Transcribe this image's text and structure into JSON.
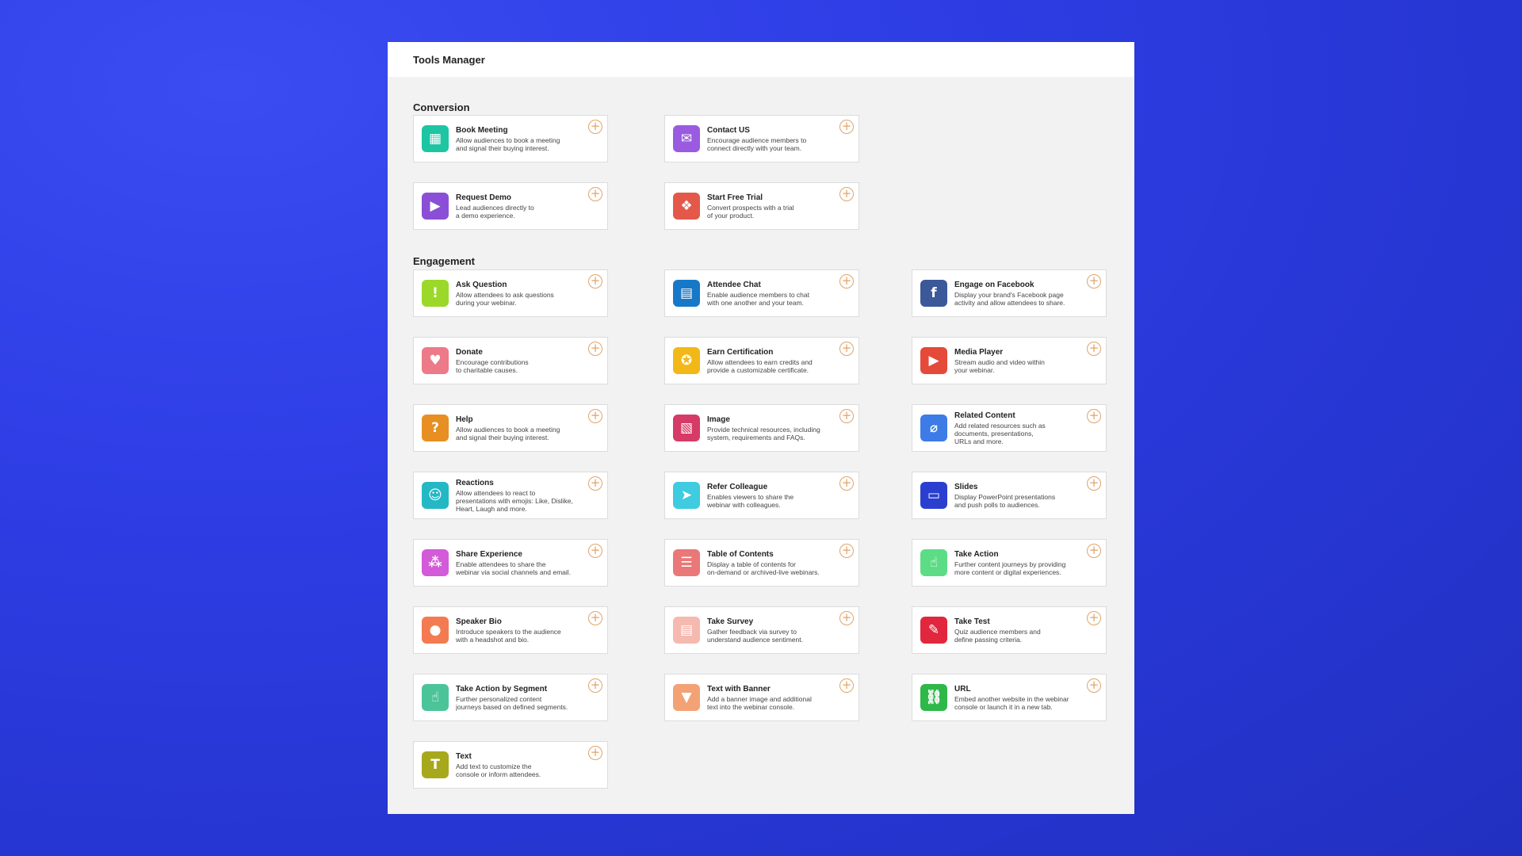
{
  "panel": {
    "title": "Tools Manager"
  },
  "sections": {
    "conversion": {
      "title": "Conversion",
      "items": [
        {
          "title": "Book Meeting",
          "desc": "Allow audiences to book a meeting\nand signal their buying interest.",
          "icon": "calendar-icon",
          "color": "#1dc5a3",
          "glyph": "▦"
        },
        {
          "title": "Contact US",
          "desc": "Encourage audience members to\nconnect directly with your team.",
          "icon": "envelope-icon",
          "color": "#9a5be0",
          "glyph": "✉"
        },
        {
          "title": "Request Demo",
          "desc": "Lead audiences directly to\na demo experience.",
          "icon": "video-play-icon",
          "color": "#8a4fd6",
          "glyph": "▶"
        },
        {
          "title": "Start Free Trial",
          "desc": "Convert prospects with a trial\nof your product.",
          "icon": "gift-icon",
          "color": "#e4584a",
          "glyph": "❖"
        }
      ]
    },
    "engagement": {
      "title": "Engagement",
      "items": [
        {
          "title": "Ask Question",
          "desc": "Allow attendees to ask questions\nduring your webinar.",
          "icon": "question-bubble-icon",
          "color": "#9bd82a",
          "glyph": "!"
        },
        {
          "title": "Attendee Chat",
          "desc": "Enable audience members to chat\nwith one another and your team.",
          "icon": "chat-icon",
          "color": "#1878c8",
          "glyph": "▤"
        },
        {
          "title": "Engage on Facebook",
          "desc": "Display your brand's Facebook page\nactivity and allow attendees to share.",
          "icon": "facebook-icon",
          "color": "#3b5898",
          "glyph": "f"
        },
        {
          "title": "Donate",
          "desc": "Encourage contributions\nto charitable causes.",
          "icon": "heart-icon",
          "color": "#ec7a88",
          "glyph": "♥"
        },
        {
          "title": "Earn Certification",
          "desc": "Allow attendees to earn credits and\nprovide a customizable certificate.",
          "icon": "ribbon-icon",
          "color": "#f2b818",
          "glyph": "✪"
        },
        {
          "title": "Media Player",
          "desc": "Stream audio and video within\nyour webinar.",
          "icon": "play-icon",
          "color": "#e4493a",
          "glyph": "▶"
        },
        {
          "title": "Help",
          "desc": "Allow audiences to book a meeting\nand signal their buying interest.",
          "icon": "help-icon",
          "color": "#e78f22",
          "glyph": "?"
        },
        {
          "title": "Image",
          "desc": "Provide technical resources, including\nsystem, requirements and FAQs.",
          "icon": "image-icon",
          "color": "#d63a66",
          "glyph": "▧"
        },
        {
          "title": "Related Content",
          "desc": "Add related resources such as\ndocuments, presentations,\nURLs and more.",
          "icon": "paperclip-icon",
          "color": "#3d7be6",
          "glyph": "⌀"
        },
        {
          "title": "Reactions",
          "desc": "Allow attendees to react to\npresentations with emojis: Like, Dislike,\nHeart, Laugh and more.",
          "icon": "smiley-icon",
          "color": "#23b8c4",
          "glyph": "☺"
        },
        {
          "title": "Refer Colleague",
          "desc": "Enables viewers to share the\nwebinar with colleagues.",
          "icon": "paper-plane-icon",
          "color": "#3fcbe0",
          "glyph": "➤"
        },
        {
          "title": "Slides",
          "desc": "Display PowerPoint presentations\nand push polls to audiences.",
          "icon": "presentation-icon",
          "color": "#2a3fd0",
          "glyph": "▭"
        },
        {
          "title": "Share Experience",
          "desc": "Enable attendees to share the\nwebinar via social channels and email.",
          "icon": "share-icon",
          "color": "#d35ad8",
          "glyph": "⁂"
        },
        {
          "title": "Table of Contents",
          "desc": "Display a table of contents for\non-demand or archived-live webinars.",
          "icon": "list-icon",
          "color": "#ea7878",
          "glyph": "☰"
        },
        {
          "title": "Take Action",
          "desc": "Further content journeys by providing\nmore content or digital experiences.",
          "icon": "pointer-hand-icon",
          "color": "#5ddc86",
          "glyph": "☝"
        },
        {
          "title": "Speaker Bio",
          "desc": "Introduce speakers to the audience\nwith a headshot and bio.",
          "icon": "person-icon",
          "color": "#f47a52",
          "glyph": "●"
        },
        {
          "title": "Take Survey",
          "desc": "Gather feedback via survey to\nunderstand audience sentiment.",
          "icon": "clipboard-icon",
          "color": "#f5b9b0",
          "glyph": "▤"
        },
        {
          "title": "Take Test",
          "desc": "Quiz audience members and\ndefine passing criteria.",
          "icon": "test-icon",
          "color": "#e0273e",
          "glyph": "✎"
        },
        {
          "title": "Take Action by Segment",
          "desc": "Further personalized content\njourneys based on defined segments.",
          "icon": "segment-hand-icon",
          "color": "#4cc49a",
          "glyph": "☝"
        },
        {
          "title": "Text with Banner",
          "desc": "Add a banner image and additional\ntext into the webinar console.",
          "icon": "banner-icon",
          "color": "#f3a276",
          "glyph": "▼"
        },
        {
          "title": "URL",
          "desc": "Embed another website in the webinar\nconsole or launch it in a new tab.",
          "icon": "link-icon",
          "color": "#2fb84a",
          "glyph": "⛓"
        },
        {
          "title": "Text",
          "desc": "Add text to customize the\nconsole or inform attendees.",
          "icon": "text-icon",
          "color": "#a7a81c",
          "glyph": "T"
        }
      ]
    }
  },
  "add_label": "+"
}
